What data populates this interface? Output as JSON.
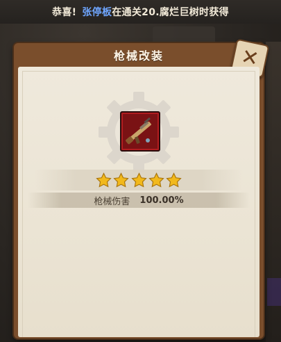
{
  "notice": {
    "prefix": "恭喜!",
    "player": "张停板",
    "suffix": "在通关20.腐烂巨树时获得"
  },
  "panel": {
    "title": "枪械改装",
    "close_icon": "close-x-icon"
  },
  "item": {
    "icon": "rifle-icon",
    "stars": 5
  },
  "stat": {
    "label": "枪械伤害",
    "value": "100.00%"
  },
  "colors": {
    "notice_highlight": "#6fa6ff",
    "panel_wood": "#7a4e2c",
    "paper": "#ebe4d4",
    "star": "#f2b91c",
    "item_bg": "#7a1214"
  }
}
